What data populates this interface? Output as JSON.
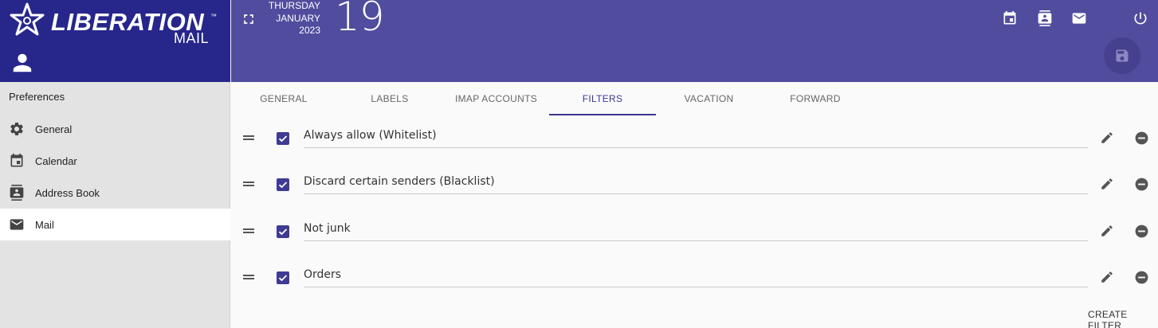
{
  "app": {
    "brand_name": "LIBERATION",
    "brand_sub": "MAIL",
    "brand_tm": "™",
    "brand_color": "#27268b",
    "header_color": "#504c9e",
    "accent_color": "#3a3690"
  },
  "header": {
    "weekday": "THURSDAY",
    "month": "JANUARY",
    "year": "2023",
    "day": "19",
    "icons": [
      "fullscreen-icon",
      "calendar-icon",
      "contacts-icon",
      "mail-icon",
      "power-icon",
      "save-icon"
    ]
  },
  "sidebar": {
    "title": "Preferences",
    "items": [
      {
        "label": "General",
        "icon": "gear-icon"
      },
      {
        "label": "Calendar",
        "icon": "calendar-icon"
      },
      {
        "label": "Address Book",
        "icon": "contacts-icon"
      },
      {
        "label": "Mail",
        "icon": "mail-icon",
        "active": true
      }
    ]
  },
  "tabs": [
    {
      "label": "GENERAL"
    },
    {
      "label": "LABELS"
    },
    {
      "label": "IMAP ACCOUNTS"
    },
    {
      "label": "FILTERS",
      "active": true
    },
    {
      "label": "VACATION"
    },
    {
      "label": "FORWARD"
    }
  ],
  "filters": [
    {
      "name": "Always allow (Whitelist)",
      "enabled": true
    },
    {
      "name": "Discard certain senders (Blacklist)",
      "enabled": true
    },
    {
      "name": "Not junk",
      "enabled": true
    },
    {
      "name": "Orders",
      "enabled": true
    }
  ],
  "actions": {
    "create_filter": "CREATE FILTER"
  }
}
